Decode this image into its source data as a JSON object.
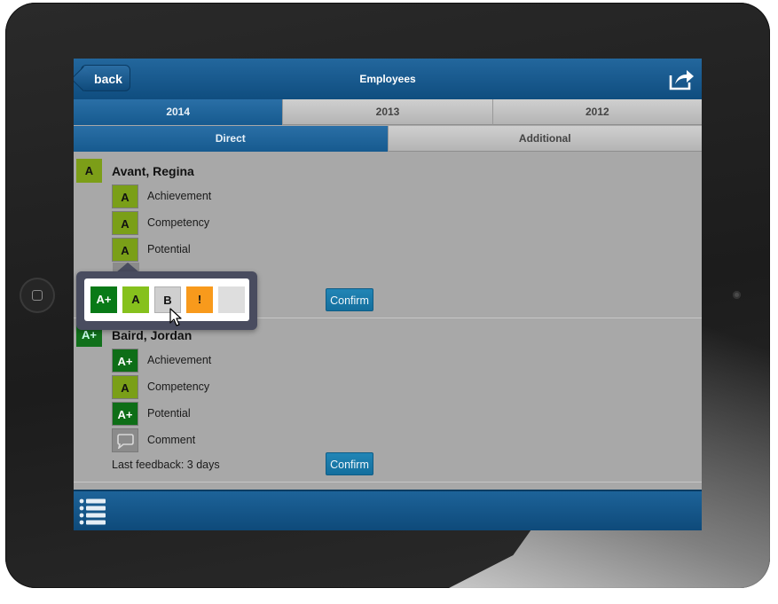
{
  "header": {
    "title": "Employees",
    "back_label": "back"
  },
  "year_tabs": [
    {
      "label": "2014",
      "active": true
    },
    {
      "label": "2013",
      "active": false
    },
    {
      "label": "2012",
      "active": false
    }
  ],
  "type_tabs": [
    {
      "label": "Direct",
      "active": true
    },
    {
      "label": "Additional",
      "active": false
    }
  ],
  "employees": [
    {
      "name": "Avant, Regina",
      "grade": "A",
      "metrics": [
        {
          "label": "Achievement",
          "grade": "A"
        },
        {
          "label": "Competency",
          "grade": "A"
        },
        {
          "label": "Potential",
          "grade": "A"
        }
      ],
      "confirm_label": "Confirm"
    },
    {
      "name": "Baird, Jordan",
      "grade": "A+",
      "metrics": [
        {
          "label": "Achievement",
          "grade": "A+"
        },
        {
          "label": "Competency",
          "grade": "A"
        },
        {
          "label": "Potential",
          "grade": "A+"
        },
        {
          "label": "Comment",
          "icon": "speech-bubble-icon"
        }
      ],
      "feedback": "Last feedback: 3 days",
      "confirm_label": "Confirm"
    }
  ],
  "grade_picker": {
    "options": [
      "A+",
      "A",
      "B",
      "!",
      ""
    ],
    "colors": {
      "A+": "#097a17",
      "A": "#86c11d",
      "B": "#cfcfcf",
      "!": "#f89a1c",
      "none": "#dedede"
    }
  },
  "icons": {
    "share": "share-icon",
    "list": "list-icon",
    "cursor": "mouse-pointer-icon"
  },
  "colors": {
    "header": "#1a5d92",
    "tab_active": "#1f64a0",
    "confirm": "#1a7cae",
    "list_bg": "#a8a8a8"
  }
}
